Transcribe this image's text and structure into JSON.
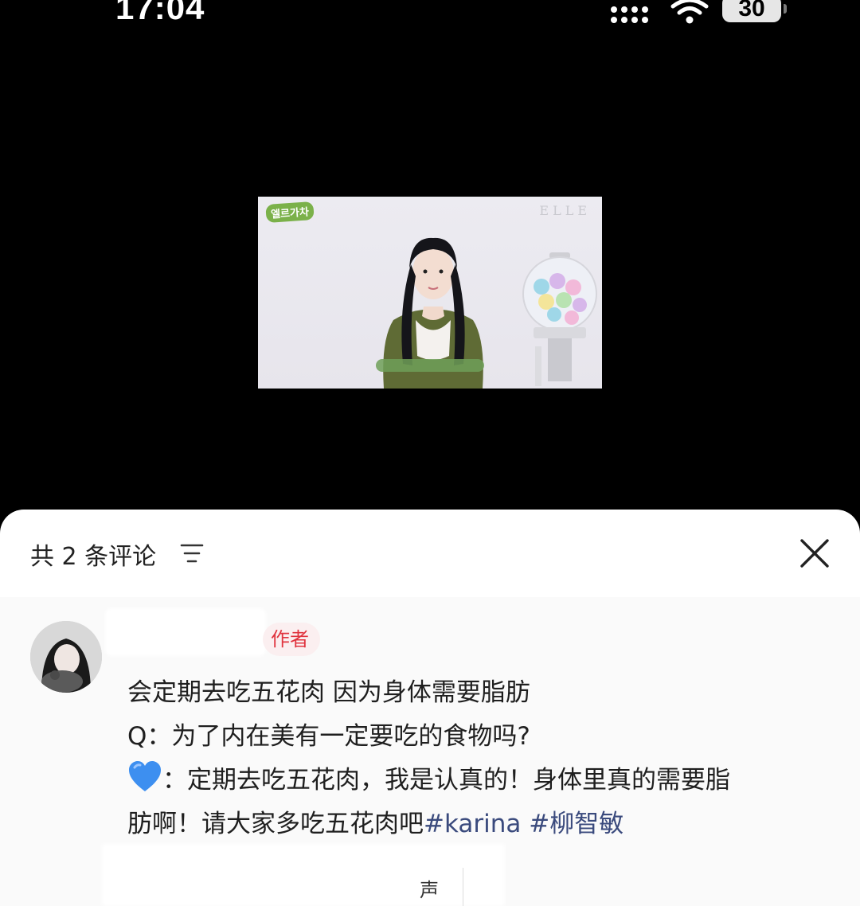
{
  "status_bar": {
    "time": "17:04",
    "battery": "30",
    "signal_icon": "signal-bars-icon",
    "wifi_icon": "wifi-icon"
  },
  "video": {
    "show_logo": "엘르가차",
    "brand_logo": "ELLE"
  },
  "comments": {
    "header": {
      "title": "共 2 条评论",
      "sort_icon": "sort-lines-icon",
      "close_icon": "close-x-icon"
    },
    "items": [
      {
        "author_badge": "作者",
        "lines": {
          "line1": "会定期去吃五花肉 因为身体需要脂肪",
          "line2": "Q：为了内在美有一定要吃的食物吗?",
          "line3_text": "：定期去吃五花肉，我是认真的！身体里真的需要脂",
          "line4_text": "肪啊！请大家多吃五花肉吧"
        },
        "hashtags": [
          "#karina",
          "#柳智敏"
        ],
        "emoji": "blue-heart-icon"
      }
    ],
    "footer_partial_text": "声"
  },
  "colors": {
    "background": "#000000",
    "sheet": "#ffffff",
    "badge_text": "#e0343f",
    "hashtag": "#3a4a7d"
  }
}
